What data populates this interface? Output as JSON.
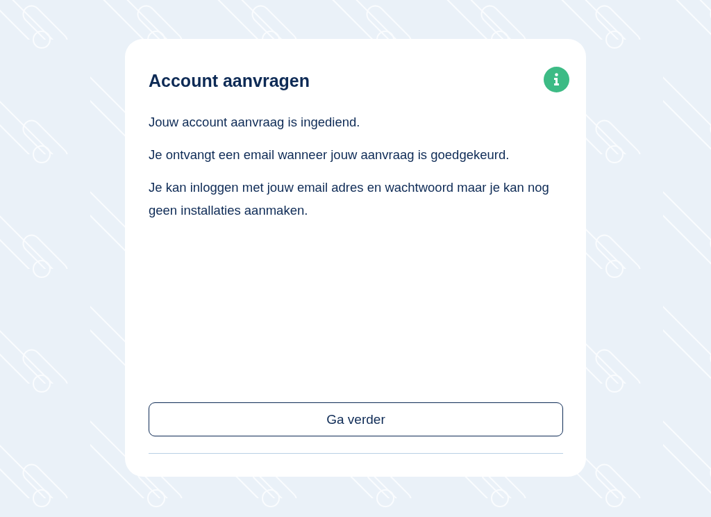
{
  "card": {
    "title": "Account aanvragen",
    "paragraphs": [
      "Jouw account aanvraag is ingediend.",
      "Je ontvangt een email wanneer jouw aanvraag is goedgekeurd.",
      "Je kan inloggen met jouw email adres en wachtwoord maar je kan nog geen installaties aanmaken."
    ],
    "button": "Ga verder"
  }
}
